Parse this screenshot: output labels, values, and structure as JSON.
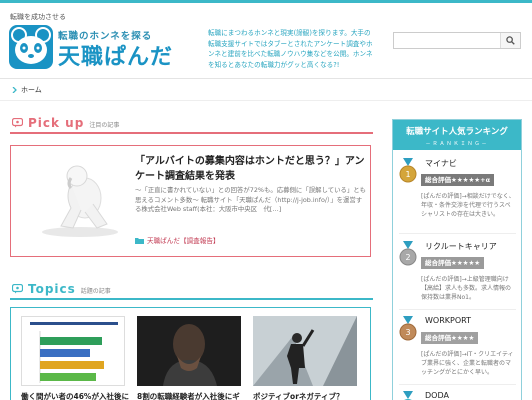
{
  "header": {
    "tagline": "転職を成功させる",
    "logo_sub": "転職のホンネを探る",
    "logo_main": "天職ぱんだ",
    "description": "転職にまつわるホンネと現実(諦観)を探ります。大手の転職支援サイトではタブーとされたアンケート調査やホンネと建前を比べた転職ノウハウ集などを公開。ホンネを知るとあなたの転職力がグッと高くなる?!",
    "search_placeholder": ""
  },
  "breadcrumb": {
    "home": "ホーム"
  },
  "pickup": {
    "title": "Pick up",
    "subtitle": "注目の記事",
    "article_title": "「アルバイトの募集内容はホントだと思う？」アンケート調査結果を発表",
    "article_desc": "～「正直に書かれていない」との回答が72%も。応募側に「誤解している」とも思えるコメント多数～ 転職サイト「天職ぱんだ（http://j-job.info/）」を運営する株式会社Web staff(本社：大阪市中央区　代[…]",
    "category": "天職ぱんだ【調査報告】"
  },
  "topics": {
    "title": "Topics",
    "subtitle": "話題の記事",
    "items": [
      {
        "title": "働く間がい者の46%が入社後に"
      },
      {
        "title": "8割の転職経験者が入社後にギ"
      },
      {
        "title": "ポジティブorネガティブ？"
      }
    ]
  },
  "sidebar": {
    "title": "転職サイト人気ランキング",
    "subtitle": "－ＲＡＮＫＩＮＧ－",
    "ranks": [
      {
        "rank": "1",
        "name": "マイナビ",
        "score": "総合評価★★★★★+α",
        "desc": "[ぱんだの評価]→相談だけでなく、年収・条件交渉を代理で行うスペシャリストの存在は大きい。",
        "medal_color": "#d4a53a"
      },
      {
        "rank": "2",
        "name": "リクルートキャリア",
        "score": "総合評価★★★★★",
        "desc": "[ぱんだの評価]→上級管理職向け【高給】求人も多数。求人情報の保持数は業界No1。",
        "medal_color": "#a8a8a8"
      },
      {
        "rank": "3",
        "name": "WORKPORT",
        "score": "総合評価★★★★",
        "desc": "[ぱんだの評価]→IT・クリエイティブ業界に強く、企業と転職者のマッチングがとにかく早い。",
        "medal_color": "#c08a5a"
      },
      {
        "rank": "4",
        "name": "DODA",
        "score": "",
        "desc": "",
        "medal_color": "#3cb8c8"
      }
    ]
  },
  "colors": {
    "accent": "#3cb8c8",
    "pickup": "#e56e7a",
    "logo": "#1a93c4"
  }
}
